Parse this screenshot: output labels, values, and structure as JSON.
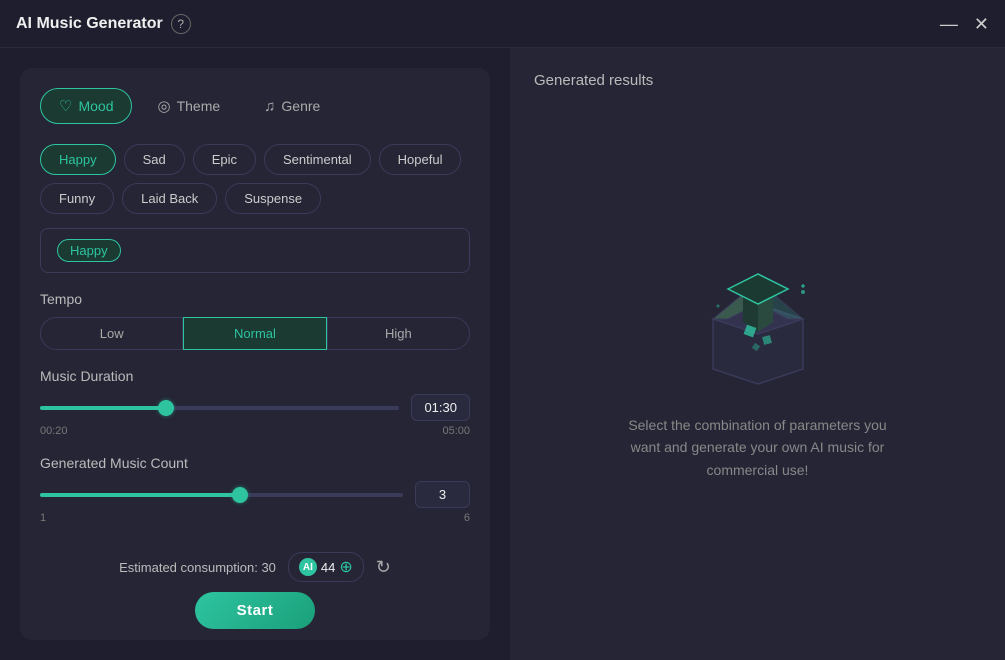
{
  "titlebar": {
    "title": "AI Music Generator",
    "help_label": "?",
    "minimize_label": "—",
    "close_label": "✕"
  },
  "tabs": [
    {
      "id": "mood",
      "label": "Mood",
      "icon": "♡",
      "active": true
    },
    {
      "id": "theme",
      "label": "Theme",
      "icon": "◎",
      "active": false
    },
    {
      "id": "genre",
      "label": "Genre",
      "icon": "♫",
      "active": false
    }
  ],
  "mood": {
    "options": [
      {
        "id": "happy",
        "label": "Happy",
        "selected": true
      },
      {
        "id": "sad",
        "label": "Sad",
        "selected": false
      },
      {
        "id": "epic",
        "label": "Epic",
        "selected": false
      },
      {
        "id": "sentimental",
        "label": "Sentimental",
        "selected": false
      },
      {
        "id": "hopeful",
        "label": "Hopeful",
        "selected": false
      },
      {
        "id": "funny",
        "label": "Funny",
        "selected": false
      },
      {
        "id": "laid_back",
        "label": "Laid Back",
        "selected": false
      },
      {
        "id": "suspense",
        "label": "Suspense",
        "selected": false
      }
    ],
    "selected_tag": "Happy"
  },
  "tempo": {
    "label": "Tempo",
    "options": [
      {
        "id": "low",
        "label": "Low",
        "active": false
      },
      {
        "id": "normal",
        "label": "Normal",
        "active": true
      },
      {
        "id": "high",
        "label": "High",
        "active": false
      }
    ]
  },
  "music_duration": {
    "label": "Music Duration",
    "min": "00:20",
    "max": "05:00",
    "value": "01:30",
    "fill_percent": 35,
    "thumb_percent": 35
  },
  "music_count": {
    "label": "Generated Music Count",
    "min": "1",
    "max": "6",
    "value": "3",
    "fill_percent": 55,
    "thumb_percent": 55
  },
  "bottom": {
    "consumption_label": "Estimated consumption: 30",
    "credits": "44",
    "start_label": "Start"
  },
  "results": {
    "title": "Generated results",
    "empty_text": "Select the combination of parameters you want and generate your own AI music for commercial use!"
  }
}
